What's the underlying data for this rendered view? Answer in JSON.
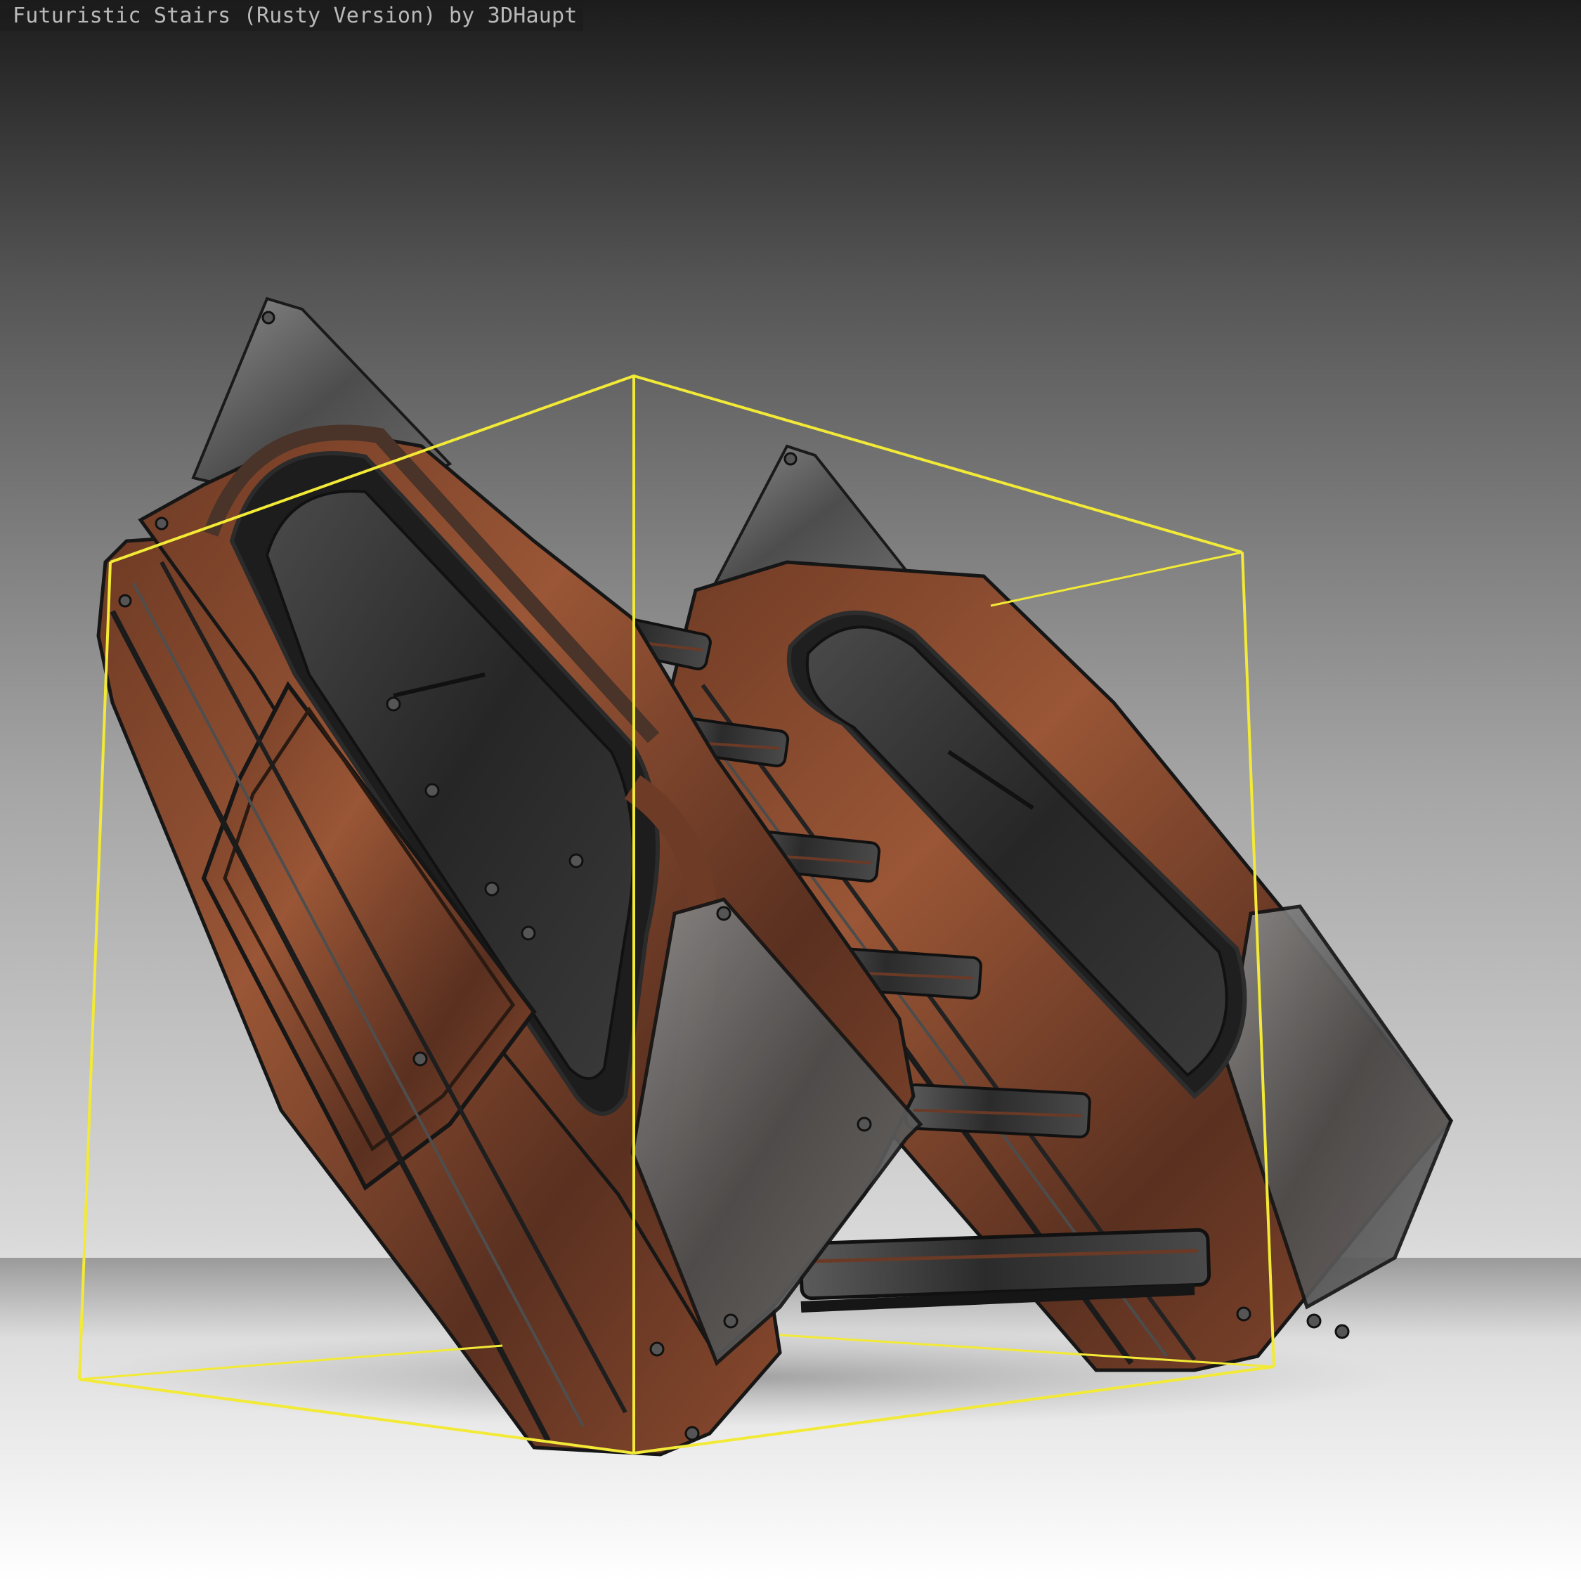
{
  "viewer": {
    "title": "Futuristic Stairs (Rusty Version) by 3DHaupt",
    "background_top": "#1c1c1c",
    "background_bottom": "#ffffff",
    "selection_color": "#f2ea36",
    "rust_color": "#8a4a2e",
    "metal_color": "#3a3a3a"
  }
}
